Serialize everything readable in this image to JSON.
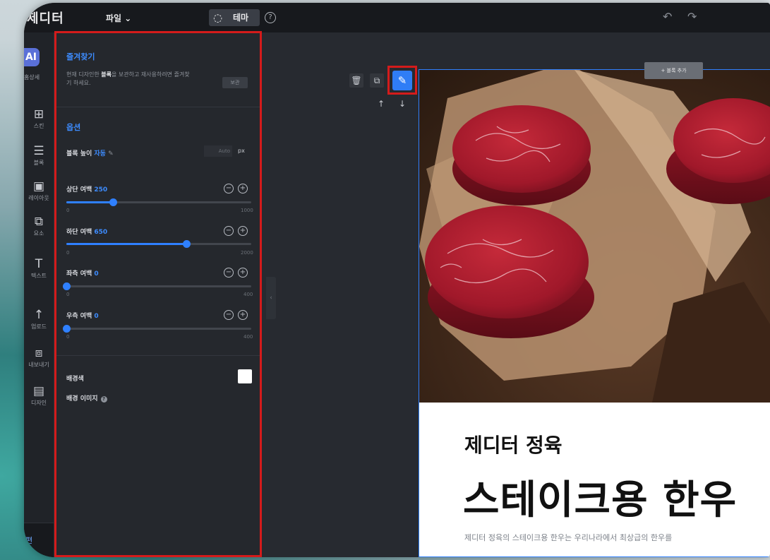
{
  "app": {
    "logo": "제디터",
    "file_menu": "파일 ⌄",
    "theme_label": "테마",
    "help": "?",
    "undo": "↶",
    "redo": "↷"
  },
  "iconbar": {
    "ai_label": "AI",
    "ai_caption": "홈상세",
    "items": [
      {
        "glyph": "⊞",
        "label": "스킨"
      },
      {
        "glyph": "☰",
        "label": "블록"
      },
      {
        "glyph": "▣",
        "label": "레이아웃"
      },
      {
        "glyph": "⧉",
        "label": "요소"
      },
      {
        "glyph": "T",
        "label": "텍스트"
      },
      {
        "glyph": "↑",
        "label": "업로드"
      },
      {
        "glyph": "⧈",
        "label": "내보내기"
      },
      {
        "glyph": "▤",
        "label": "디자인"
      }
    ],
    "bottom": "편"
  },
  "panel": {
    "favorites": {
      "title": "즐겨찾기",
      "desc_pre": "현재 디자인한 ",
      "desc_bold": "블록",
      "desc_post": "을 보관하고 재사용하려면 즐겨찾기 하세요.",
      "button": "보관"
    },
    "options": {
      "title": "옵션",
      "height_label": "블록 높이",
      "height_value": "자동",
      "height_placeholder": "Auto",
      "height_unit": "px",
      "sliders": [
        {
          "label": "상단 여백",
          "value": "250",
          "min": "0",
          "max": "1000",
          "fraction": 0.25
        },
        {
          "label": "하단 여백",
          "value": "650",
          "min": "0",
          "max": "2000",
          "fraction": 0.65
        },
        {
          "label": "좌측 여백",
          "value": "0",
          "min": "0",
          "max": "400",
          "fraction": 0
        },
        {
          "label": "우측 여백",
          "value": "0",
          "min": "0",
          "max": "400",
          "fraction": 0
        }
      ],
      "bg_color_label": "배경색",
      "bg_color": "#ffffff",
      "bg_image_label": "배경 이미지"
    }
  },
  "canvas": {
    "add_block": "+ 블록 추가",
    "subtitle": "제디터 정육",
    "title": "스테이크용 한우",
    "desc": "제디터 정육의 스테이크용 한우는 우리나라에서 최상급의 한우를"
  },
  "colors": {
    "accent": "#2f80ff",
    "highlight": "#d41b1b",
    "panel_bg": "#25282d"
  }
}
